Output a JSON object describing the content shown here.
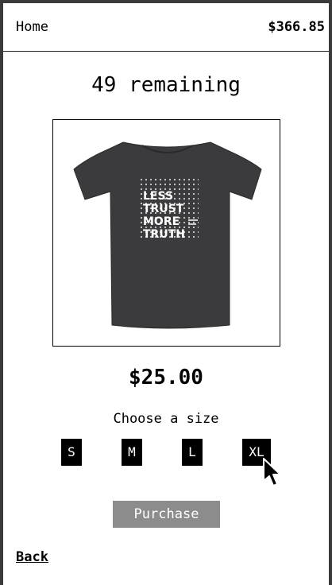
{
  "header": {
    "home_label": "Home",
    "balance": "$366.85"
  },
  "product": {
    "remaining": "49 remaining",
    "price": "$25.00",
    "image_icon": "tshirt-image",
    "shirt_text": [
      "LESS",
      "TRUST",
      "MORE",
      "TRUTH"
    ],
    "shirt_color": "#3b3b3d"
  },
  "sizes": {
    "prompt": "Choose a size",
    "options": [
      "S",
      "M",
      "L",
      "XL"
    ]
  },
  "actions": {
    "purchase_label": "Purchase",
    "back_label": "Back"
  },
  "colors": {
    "size_button": "#000000",
    "purchase_button": "#8c8c8c"
  }
}
